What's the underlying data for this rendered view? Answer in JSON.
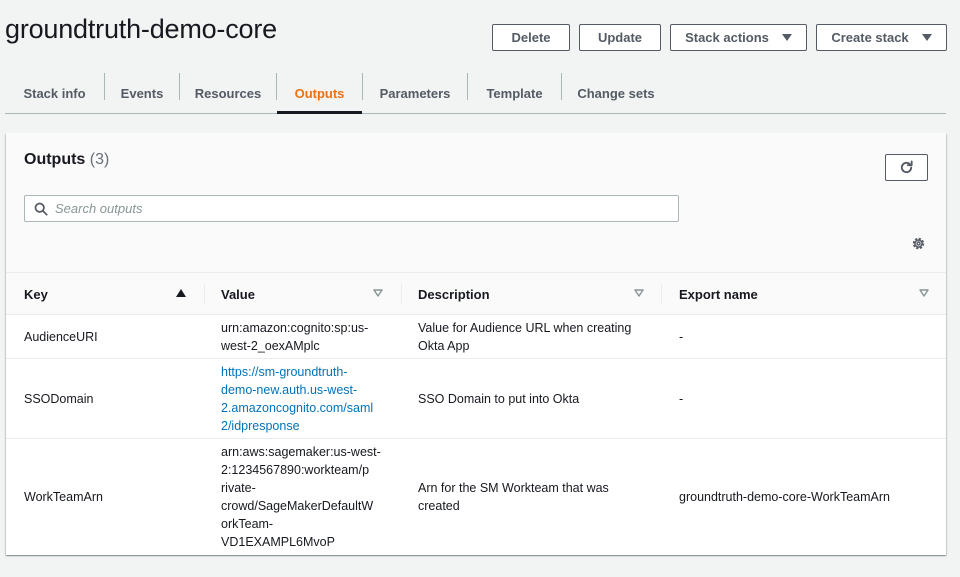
{
  "page": {
    "title": "groundtruth-demo-core"
  },
  "header_buttons": {
    "delete": "Delete",
    "update": "Update",
    "stack_actions": "Stack actions",
    "create_stack": "Create stack"
  },
  "tabs": [
    {
      "label": "Stack info"
    },
    {
      "label": "Events"
    },
    {
      "label": "Resources"
    },
    {
      "label": "Outputs",
      "active": true
    },
    {
      "label": "Parameters"
    },
    {
      "label": "Template"
    },
    {
      "label": "Change sets"
    }
  ],
  "outputs": {
    "title": "Outputs",
    "count": "(3)",
    "search_placeholder": "Search outputs",
    "search_value": "",
    "columns": {
      "key": "Key",
      "value": "Value",
      "description": "Description",
      "export_name": "Export name"
    },
    "rows": [
      {
        "key": "AudienceURI",
        "value": "urn:amazon:cognito:sp:us-west-2_oexAMplc",
        "value_lines": [
          "urn:amazon:cognito:sp:us-",
          "west-2_oexAMplc"
        ],
        "description": "Value for Audience URL when creating Okta App",
        "description_lines": [
          "Value for Audience URL when creating",
          "Okta App"
        ],
        "export_name": "-"
      },
      {
        "key": "SSODomain",
        "value": "https://sm-groundtruth-demo-new.auth.us-west-2.amazoncognito.com/saml2/idpresponse",
        "value_lines": [
          "https://sm-groundtruth-",
          "demo-new.auth.us-west-",
          "2.amazoncognito.com/saml",
          "2/idpresponse"
        ],
        "description": "SSO Domain to put into Okta",
        "export_name": "-"
      },
      {
        "key": "WorkTeamArn",
        "value": "arn:aws:sagemaker:us-west-2:1234567890:workteam/private-crowd/SageMakerDefaultWorkTeam-VD1EXAMPL6MvoP",
        "value_lines": [
          "arn:aws:sagemaker:us-west-",
          "2:1234567890:workteam/p",
          "rivate-",
          "crowd/SageMakerDefaultW",
          "orkTeam-",
          "VD1EXAMPL6MvoP"
        ],
        "description": "Arn for the SM Workteam that was created",
        "description_lines": [
          "Arn for the SM Workteam that was",
          "created"
        ],
        "export_name": "groundtruth-demo-core-WorkTeamArn"
      }
    ]
  },
  "colors": {
    "accent": "#ec7211",
    "link": "#0073bb",
    "text": "#16191f",
    "muted": "#545b64",
    "background": "#f2f3f3"
  },
  "icons": {
    "caret": "caret-down-icon",
    "refresh": "refresh-icon",
    "search": "search-icon",
    "settings": "gear-icon",
    "sort_asc": "sort-ascending-icon",
    "sort_neutral": "sort-caret-icon"
  }
}
